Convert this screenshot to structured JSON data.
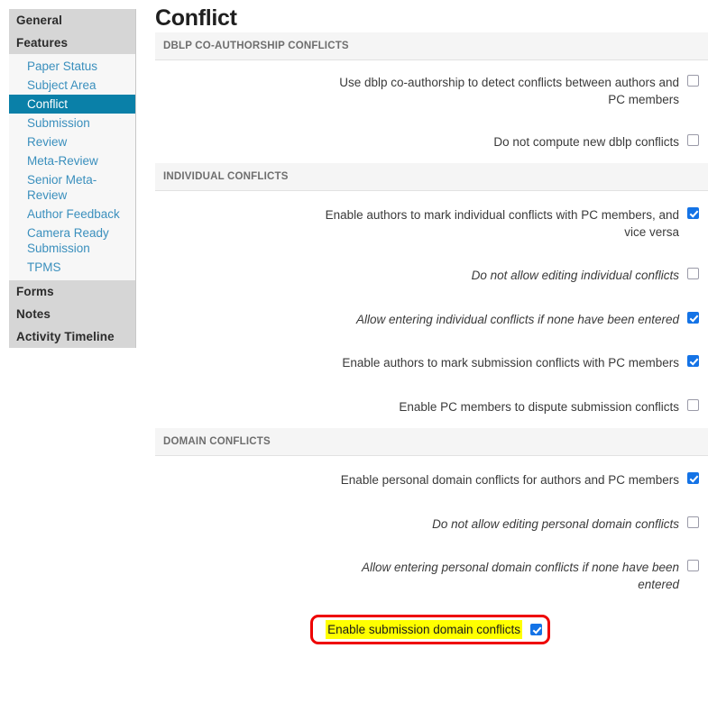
{
  "sidebar": {
    "groups": [
      {
        "type": "header",
        "label": "General",
        "name": "sidebar-group-general"
      },
      {
        "type": "header",
        "label": "Features",
        "name": "sidebar-group-features"
      }
    ],
    "feature_items": [
      {
        "label": "Paper Status",
        "active": false
      },
      {
        "label": "Subject Area",
        "active": false
      },
      {
        "label": "Conflict",
        "active": true
      },
      {
        "label": "Submission",
        "active": false
      },
      {
        "label": "Review",
        "active": false
      },
      {
        "label": "Meta-Review",
        "active": false
      },
      {
        "label": "Senior Meta-Review",
        "active": false
      },
      {
        "label": "Author Feedback",
        "active": false
      },
      {
        "label": "Camera Ready Submission",
        "active": false
      },
      {
        "label": "TPMS",
        "active": false
      }
    ],
    "footer_items": [
      {
        "label": "Forms"
      },
      {
        "label": "Notes"
      },
      {
        "label": "Activity Timeline"
      }
    ]
  },
  "main": {
    "title": "Conflict",
    "sections": [
      {
        "header": "DBLP CO-AUTHORSHIP CONFLICTS",
        "fields": [
          {
            "label": "Use dblp co-authorship to detect conflicts between authors and PC members",
            "checked": false,
            "italic": false,
            "highlighted": false
          },
          {
            "label": "Do not compute new dblp conflicts",
            "checked": false,
            "italic": false,
            "highlighted": false
          }
        ]
      },
      {
        "header": "INDIVIDUAL CONFLICTS",
        "fields": [
          {
            "label": "Enable authors to mark individual conflicts with PC members, and vice versa",
            "checked": true,
            "italic": false,
            "highlighted": false
          },
          {
            "label": "Do not allow editing individual conflicts",
            "checked": false,
            "italic": true,
            "highlighted": false
          },
          {
            "label": "Allow entering individual conflicts if none have been entered",
            "checked": true,
            "italic": true,
            "highlighted": false
          },
          {
            "label": "Enable authors to mark submission conflicts with PC members",
            "checked": true,
            "italic": false,
            "highlighted": false
          },
          {
            "label": "Enable PC members to dispute submission conflicts",
            "checked": false,
            "italic": false,
            "highlighted": false
          }
        ]
      },
      {
        "header": "DOMAIN CONFLICTS",
        "fields": [
          {
            "label": "Enable personal domain conflicts for authors and PC members",
            "checked": true,
            "italic": false,
            "highlighted": false
          },
          {
            "label": "Do not allow editing personal domain conflicts",
            "checked": false,
            "italic": true,
            "highlighted": false
          },
          {
            "label": "Allow entering personal domain conflicts if none have been entered",
            "checked": false,
            "italic": true,
            "highlighted": false
          },
          {
            "label": "Enable submission domain conflicts",
            "checked": true,
            "italic": false,
            "highlighted": true
          }
        ]
      }
    ]
  },
  "colors": {
    "active_nav": "#0a80a8",
    "link": "#3a8fbd",
    "checkbox_checked": "#1473e6",
    "highlight_border": "#ee0000",
    "highlight_fill": "#ffff00",
    "group_header_bg": "#d6d6d6",
    "section_header_bg": "#f5f5f5"
  }
}
